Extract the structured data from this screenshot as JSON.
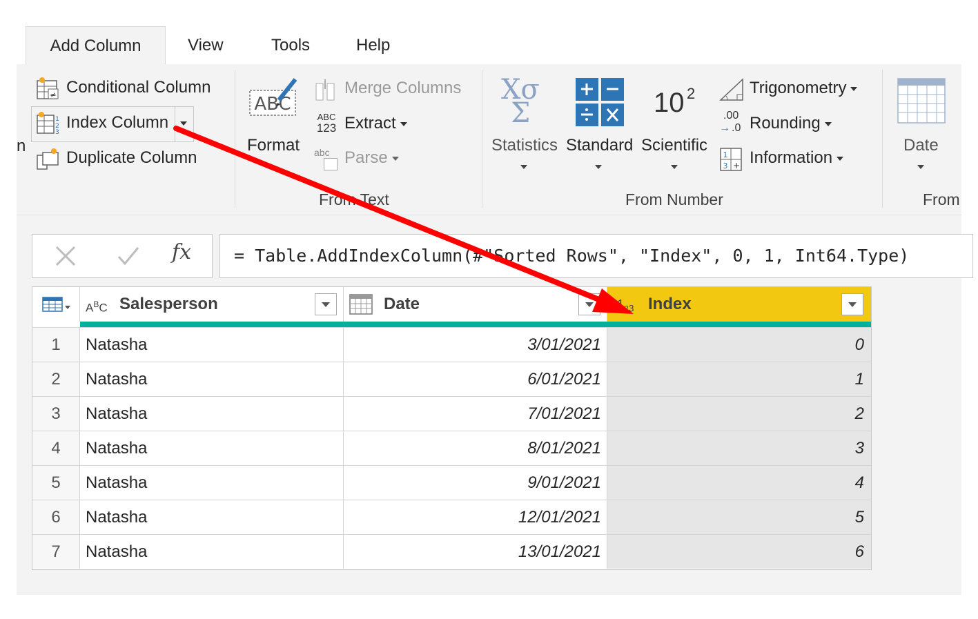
{
  "tabs": [
    "Add Column",
    "View",
    "Tools",
    "Help"
  ],
  "ribbon": {
    "general": {
      "cut_label": "n",
      "conditional_column": "Conditional Column",
      "index_column": "Index Column",
      "duplicate_column": "Duplicate Column"
    },
    "from_text": {
      "format": "Format",
      "merge_columns": "Merge Columns",
      "extract": "Extract",
      "extract_icon_top": "ABC",
      "extract_icon_bottom": "123",
      "parse": "Parse",
      "parse_icon": "abc",
      "group_label": "From Text"
    },
    "from_number": {
      "statistics": "Statistics",
      "standard": "Standard",
      "scientific": "Scientific",
      "scientific_base": "10",
      "scientific_exp": "2",
      "trigonometry": "Trigonometry",
      "rounding": "Rounding",
      "rounding_icon": ".00",
      "rounding_icon_small": ".0",
      "information": "Information",
      "group_label": "From Number"
    },
    "from_date": {
      "date": "Date",
      "group_label": "From"
    }
  },
  "formula_bar": {
    "fx": "fx",
    "formula": "= Table.AddIndexColumn(#\"Sorted Rows\", \"Index\", 0, 1, Int64.Type)"
  },
  "table": {
    "columns": [
      {
        "name": "Salesperson",
        "type_icon": "ABC"
      },
      {
        "name": "Date",
        "type_icon": "calendar"
      },
      {
        "name": "Index",
        "type_icon": "123"
      }
    ],
    "rows": [
      {
        "n": "1",
        "salesperson": "Natasha",
        "date": "3/01/2021",
        "index": "0"
      },
      {
        "n": "2",
        "salesperson": "Natasha",
        "date": "6/01/2021",
        "index": "1"
      },
      {
        "n": "3",
        "salesperson": "Natasha",
        "date": "7/01/2021",
        "index": "2"
      },
      {
        "n": "4",
        "salesperson": "Natasha",
        "date": "8/01/2021",
        "index": "3"
      },
      {
        "n": "5",
        "salesperson": "Natasha",
        "date": "9/01/2021",
        "index": "4"
      },
      {
        "n": "6",
        "salesperson": "Natasha",
        "date": "12/01/2021",
        "index": "5"
      },
      {
        "n": "7",
        "salesperson": "Natasha",
        "date": "13/01/2021",
        "index": "6"
      }
    ]
  },
  "colors": {
    "index_header": "#f2c811",
    "teal_quality_bar": "#00b09b",
    "arrow": "#ff0000",
    "icon_blue": "#2e75b6"
  }
}
